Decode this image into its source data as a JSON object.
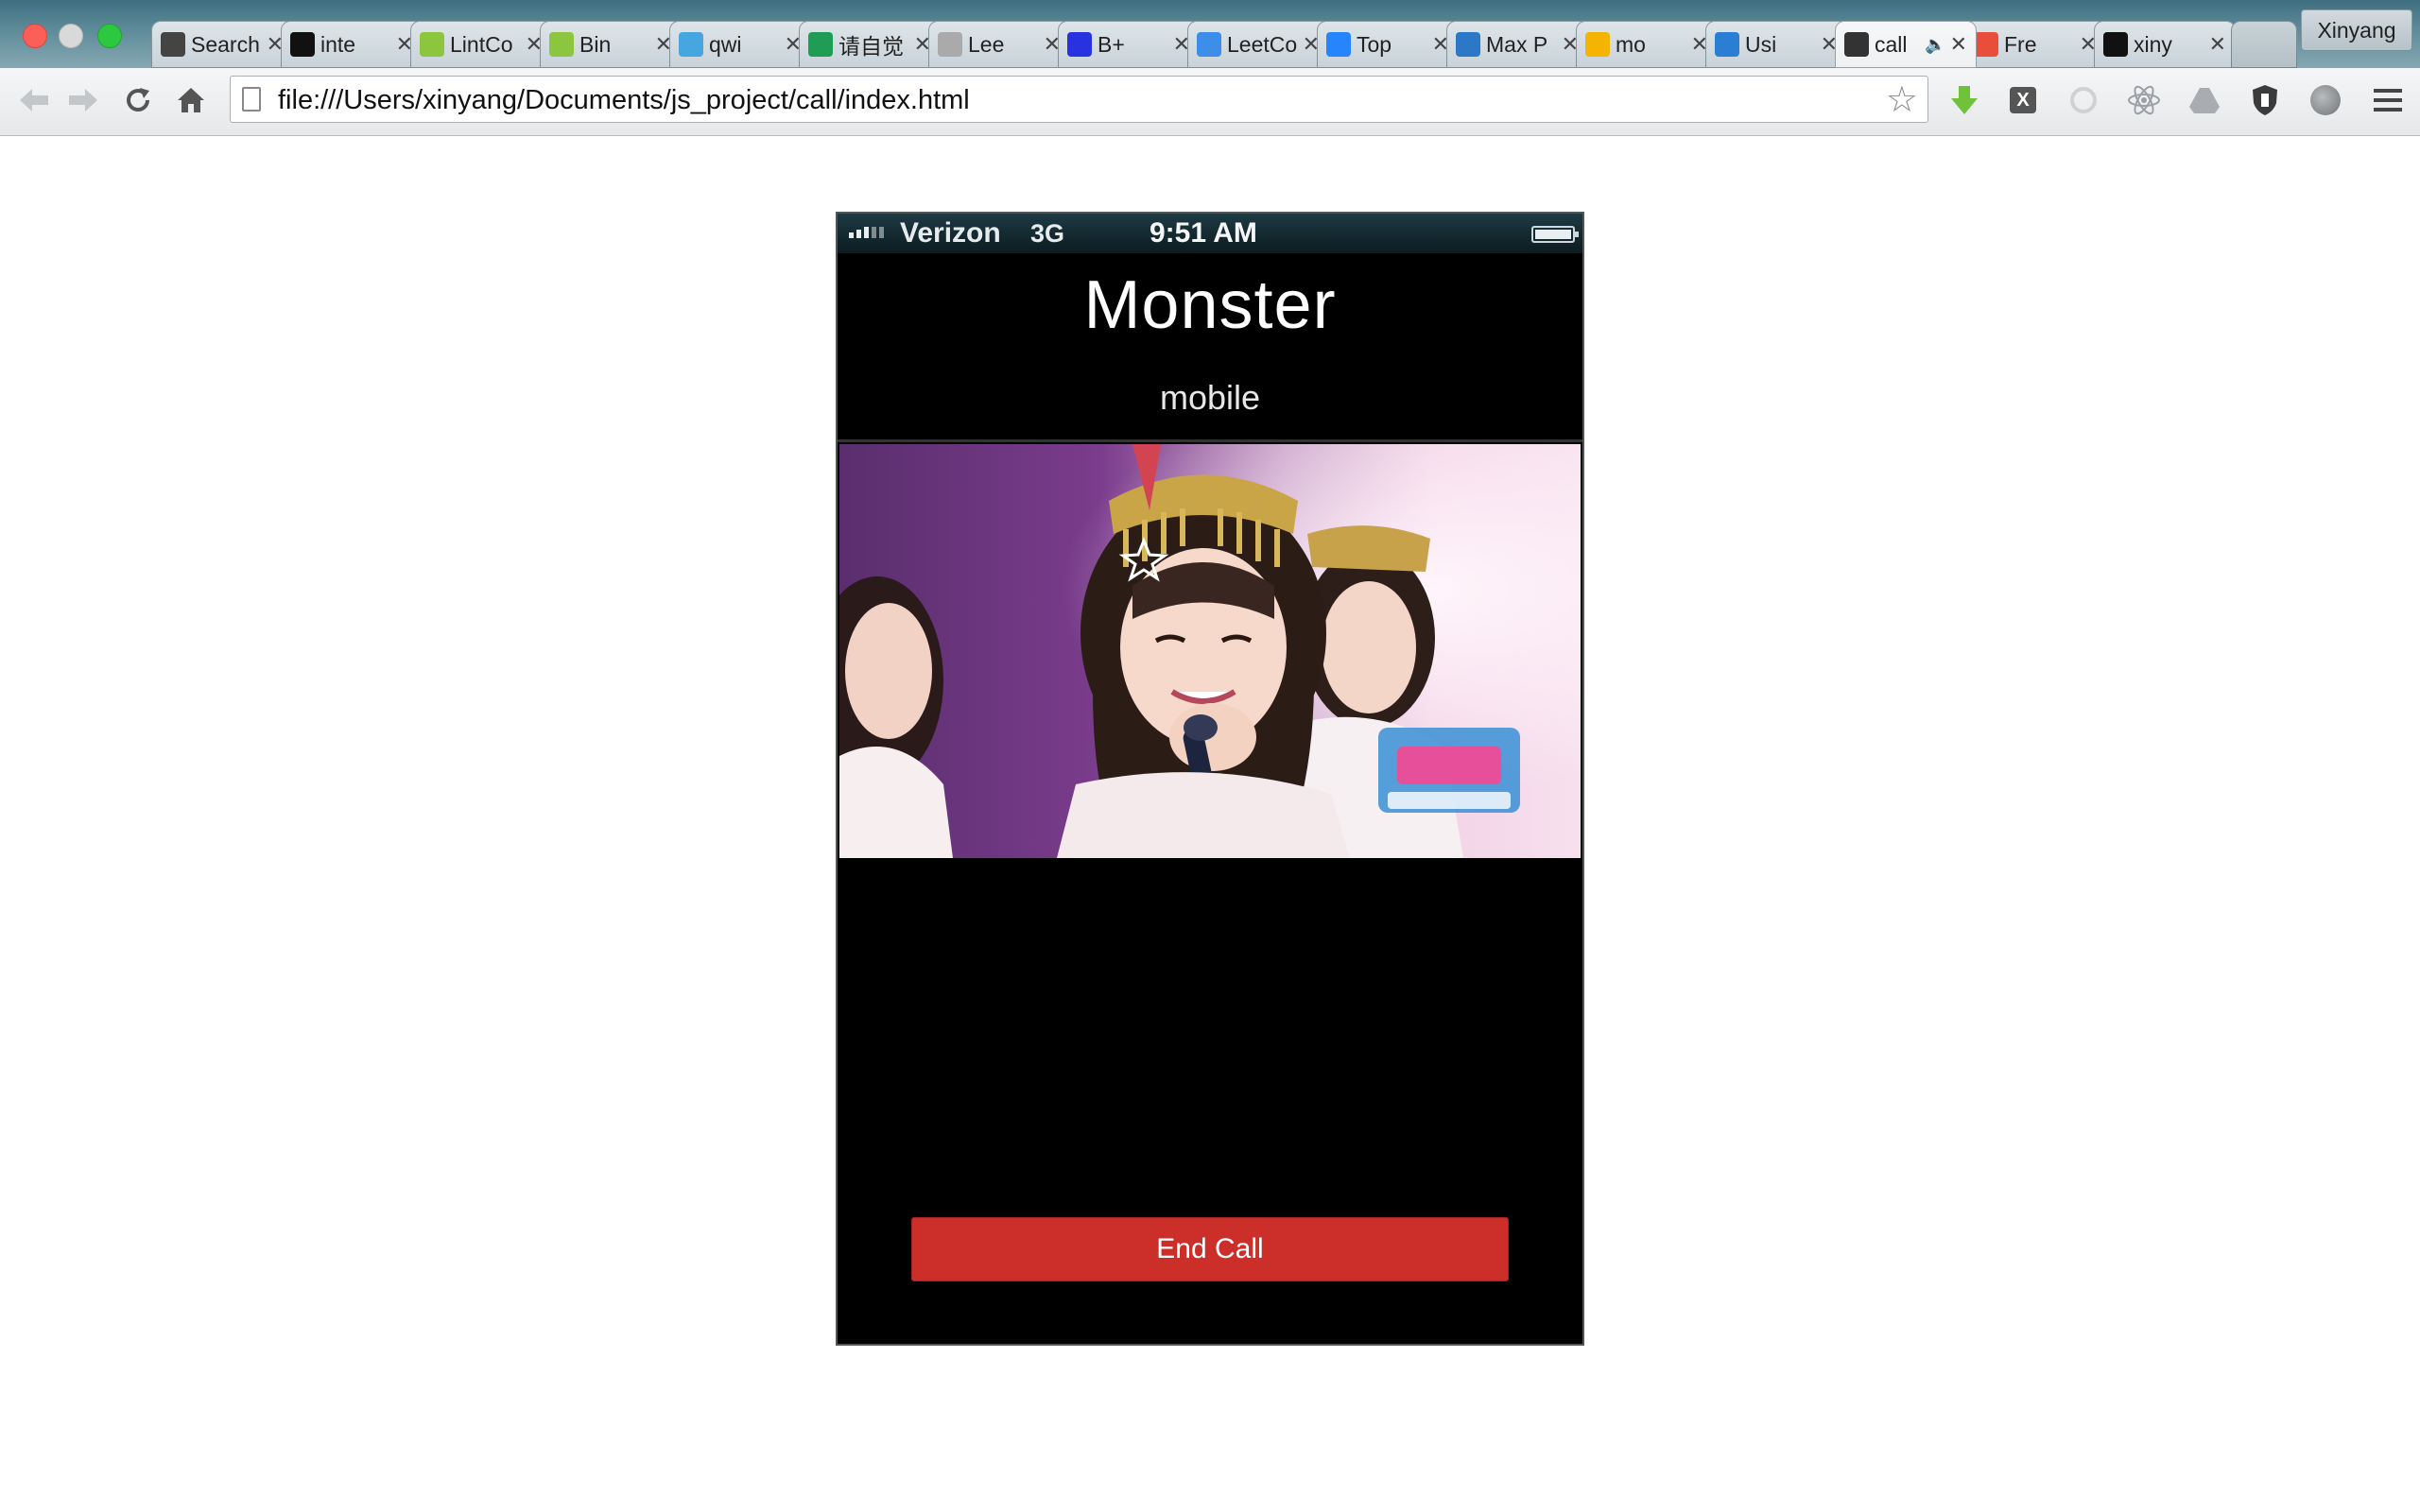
{
  "browser": {
    "tabs": [
      {
        "title": "Search",
        "icon": "book-icon",
        "color": "#444444"
      },
      {
        "title": "inte",
        "icon": "github-icon",
        "color": "#111111"
      },
      {
        "title": "LintCo",
        "icon": "lintcode-icon",
        "color": "#8cc63f"
      },
      {
        "title": "Bin",
        "icon": "lintcode-icon",
        "color": "#8cc63f"
      },
      {
        "title": "qwi",
        "icon": "cloud-icon",
        "color": "#46a7e0"
      },
      {
        "title": "请自觉",
        "icon": "sheet-icon",
        "color": "#1f9d55"
      },
      {
        "title": "Lee",
        "icon": "image-icon",
        "color": "#aaaaaa"
      },
      {
        "title": "B+",
        "icon": "baidu-paw-icon",
        "color": "#2932e1"
      },
      {
        "title": "LeetCo",
        "icon": "dropbox-icon",
        "color": "#3d8ee8"
      },
      {
        "title": "Top",
        "icon": "jira-icon",
        "color": "#2684ff"
      },
      {
        "title": "Max P",
        "icon": "compass-icon",
        "color": "#2d77c9"
      },
      {
        "title": "mo",
        "icon": "drive-icon",
        "color": "#f4b400"
      },
      {
        "title": "Usi",
        "icon": "chat-icon",
        "color": "#2a7fd4"
      },
      {
        "title": "call",
        "icon": "speaker-icon",
        "color": "#333333",
        "active": true
      },
      {
        "title": "Fre",
        "icon": "grid-icon",
        "color": "#e94e3c"
      },
      {
        "title": "xiny",
        "icon": "github-icon",
        "color": "#111111"
      }
    ],
    "profile_name": "Xinyang",
    "url": "file:///Users/xinyang/Documents/js_project/call/index.html"
  },
  "phone": {
    "carrier": "Verizon",
    "network": "3G",
    "time": "9:51 AM",
    "caller_name": "Monster",
    "caller_label": "mobile",
    "end_call_label": "End Call",
    "end_call_color": "#cc2f2a"
  }
}
